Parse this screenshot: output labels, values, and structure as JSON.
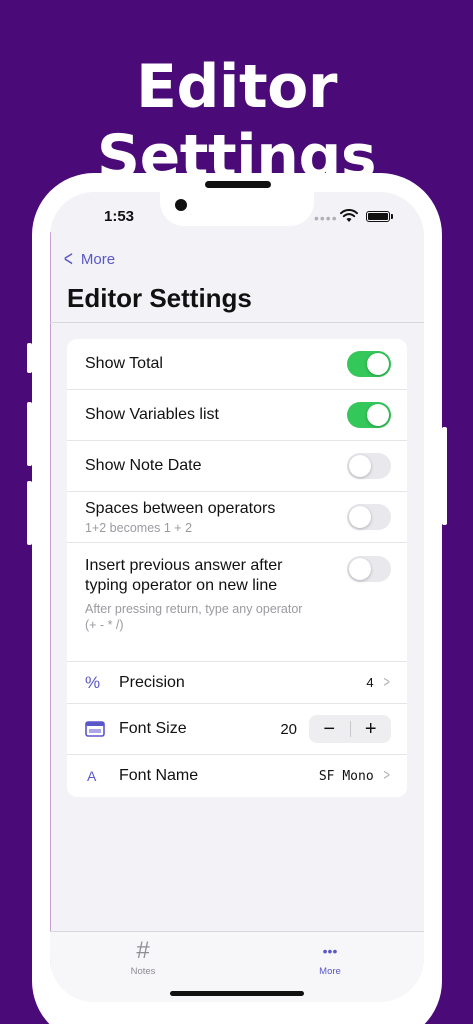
{
  "promo": {
    "title": "Editor Settings"
  },
  "status_bar": {
    "time": "1:53"
  },
  "nav": {
    "back_label": "More",
    "title": "Editor Settings"
  },
  "settings": {
    "toggles": [
      {
        "title": "Show Total",
        "subtitle": "",
        "on": true
      },
      {
        "title": "Show Variables list",
        "subtitle": "",
        "on": true
      },
      {
        "title": "Show Note Date",
        "subtitle": "",
        "on": false
      },
      {
        "title": "Spaces between operators",
        "subtitle": "1+2 becomes 1 + 2",
        "on": false
      },
      {
        "title": "Insert previous answer after typing operator on new line",
        "subtitle": "After pressing return, type any operator (+ - * /)",
        "on": false
      }
    ],
    "precision": {
      "icon": "%",
      "label": "Precision",
      "value": "4"
    },
    "font_size": {
      "label": "Font Size",
      "value": "20",
      "minus": "−",
      "plus": "+"
    },
    "font_name": {
      "icon": "A",
      "label": "Font Name",
      "value": "SF Mono"
    }
  },
  "tabbar": {
    "notes": {
      "icon": "#",
      "label": "Notes"
    },
    "more": {
      "icon": "•••",
      "label": "More"
    }
  },
  "colors": {
    "accent": "#5a57c8",
    "toggle_on": "#34c759",
    "background": "#4a0a78"
  }
}
